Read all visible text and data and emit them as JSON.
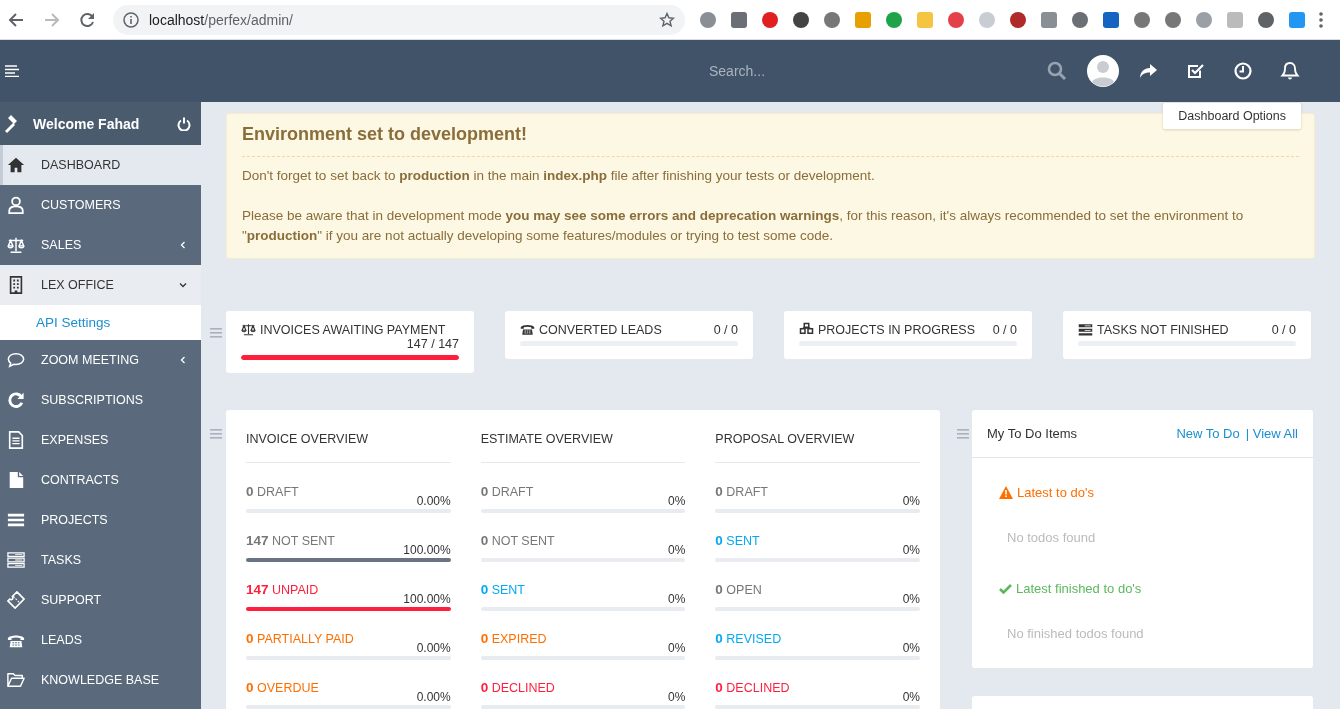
{
  "browser": {
    "url_host": "localhost",
    "url_path": "/perfex/admin/"
  },
  "header": {
    "search": {
      "placeholder": "Search..."
    }
  },
  "dashboard_options": "Dashboard Options",
  "sidebar": {
    "welcome": "Welcome Fahad",
    "items": [
      {
        "label": "DASHBOARD",
        "kind": "link",
        "selected": true
      },
      {
        "label": "CUSTOMERS",
        "kind": "link",
        "selected": false
      },
      {
        "label": "SALES",
        "kind": "submenu",
        "selected": false,
        "expanded": false
      },
      {
        "label": "LEX OFFICE",
        "kind": "submenu",
        "selected": false,
        "expanded": true,
        "children": [
          {
            "label": "API Settings",
            "selected": false
          }
        ]
      },
      {
        "label": "ZOOM MEETING",
        "kind": "submenu",
        "selected": false,
        "expanded": false
      },
      {
        "label": "SUBSCRIPTIONS",
        "kind": "link",
        "selected": false
      },
      {
        "label": "EXPENSES",
        "kind": "link",
        "selected": false
      },
      {
        "label": "CONTRACTS",
        "kind": "link",
        "selected": false
      },
      {
        "label": "PROJECTS",
        "kind": "link",
        "selected": false
      },
      {
        "label": "TASKS",
        "kind": "link",
        "selected": false
      },
      {
        "label": "SUPPORT",
        "kind": "link",
        "selected": false
      },
      {
        "label": "LEADS",
        "kind": "link",
        "selected": false
      },
      {
        "label": "KNOWLEDGE BASE",
        "kind": "link",
        "selected": false
      }
    ]
  },
  "alert": {
    "title": "Environment set to development!",
    "paragraphs": [
      "Don't forget to set back to **production** in the main **index.php** file after finishing your tests or development.",
      "Please be aware that in development mode **you may see some errors and deprecation warnings**, for this reason, it's always recommended to set the environment to \"**production**\" if you are not actually developing some features/modules or trying to test some code."
    ]
  },
  "stats": [
    {
      "label": "INVOICES AWAITING PAYMENT",
      "value": "147 / 147",
      "level": 1
    },
    {
      "label": "CONVERTED LEADS",
      "value": "0 / 0",
      "level": 0
    },
    {
      "label": "PROJECTS IN PROGRESS",
      "value": "0 / 0",
      "level": 0
    },
    {
      "label": "TASKS NOT FINISHED",
      "value": "0 / 0",
      "level": 0
    }
  ],
  "overview": [
    {
      "title": "INVOICE OVERVIEW",
      "rows": [
        {
          "count": "0",
          "label": "DRAFT",
          "percent": "0.00%",
          "level": 0,
          "color": "#777777"
        },
        {
          "count": "147",
          "label": "NOT SENT",
          "percent": "100.00%",
          "level": 1,
          "color": "#777777"
        },
        {
          "count": "147",
          "label": "UNPAID",
          "percent": "100.00%",
          "level": 1,
          "color": "#ff1f3d"
        },
        {
          "count": "0",
          "label": "PARTIALLY PAID",
          "percent": "0.00%",
          "level": 0,
          "color": "#ff6f00"
        },
        {
          "count": "0",
          "label": "OVERDUE",
          "percent": "0.00%",
          "level": 0,
          "color": "#ff6f00"
        }
      ]
    },
    {
      "title": "ESTIMATE OVERVIEW",
      "rows": [
        {
          "count": "0",
          "label": "DRAFT",
          "percent": "0%",
          "level": 0,
          "color": "#777777"
        },
        {
          "count": "0",
          "label": "NOT SENT",
          "percent": "0%",
          "level": 0,
          "color": "#777777"
        },
        {
          "count": "0",
          "label": "SENT",
          "percent": "0%",
          "level": 0,
          "color": "#03a9f4"
        },
        {
          "count": "0",
          "label": "EXPIRED",
          "percent": "0%",
          "level": 0,
          "color": "#ff6f00"
        },
        {
          "count": "0",
          "label": "DECLINED",
          "percent": "0%",
          "level": 0,
          "color": "#ff1f3d"
        }
      ]
    },
    {
      "title": "PROPOSAL OVERVIEW",
      "rows": [
        {
          "count": "0",
          "label": "DRAFT",
          "percent": "0%",
          "level": 0,
          "color": "#777777"
        },
        {
          "count": "0",
          "label": "SENT",
          "percent": "0%",
          "level": 0,
          "color": "#03a9f4"
        },
        {
          "count": "0",
          "label": "OPEN",
          "percent": "0%",
          "level": 0,
          "color": "#777777"
        },
        {
          "count": "0",
          "label": "REVISED",
          "percent": "0%",
          "level": 0,
          "color": "#03a9f4"
        },
        {
          "count": "0",
          "label": "DECLINED",
          "percent": "0%",
          "level": 0,
          "color": "#ff1f3d"
        }
      ]
    }
  ],
  "todo": {
    "title": "My To Do Items",
    "links": [
      "New To Do",
      "| View All"
    ],
    "sections": [
      {
        "kind": "pending",
        "title": "Latest to do's",
        "empty": "No todos found"
      },
      {
        "kind": "finished",
        "title": "Latest finished to do's",
        "empty": "No finished todos found"
      }
    ]
  }
}
